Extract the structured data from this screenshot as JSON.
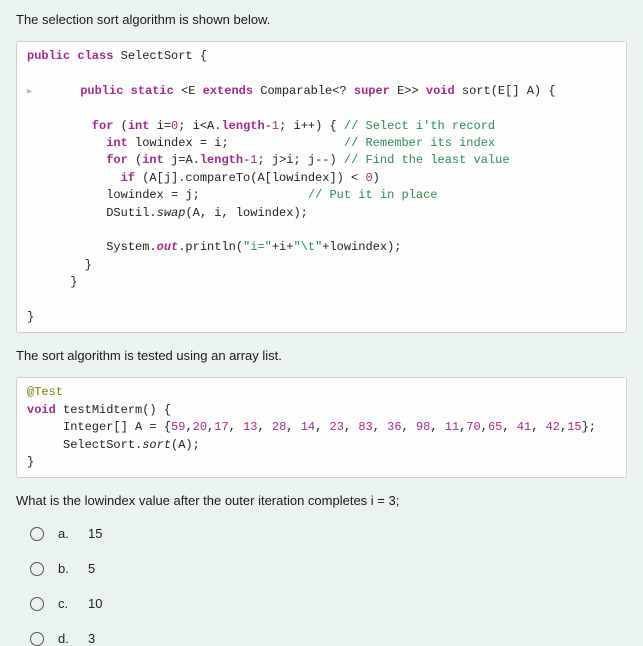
{
  "intro1": "The selection sort algorithm is shown below.",
  "code1": {
    "l1a": "public class ",
    "l1b": "SelectSort {",
    "l2a": "      public static ",
    "l2b": "<E ",
    "l2c": "extends ",
    "l2d": "Comparable<? ",
    "l2e": "super ",
    "l2f": "E>> ",
    "l2g": "void ",
    "l2h": "sort(E[] A) {",
    "l3a": "         for ",
    "l3b": "(",
    "l3c": "int ",
    "l3d": "i=",
    "l3e": "0",
    "l3f": "; i<A.",
    "l3g": "length",
    "l3h": "-",
    "l3i": "1",
    "l3j": "; i++) { ",
    "l3k": "// Select i'th record",
    "l4a": "           int ",
    "l4b": "lowindex = i;                ",
    "l4c": "// Remember its index",
    "l5a": "           for ",
    "l5b": "(",
    "l5c": "int ",
    "l5d": "j=A.",
    "l5e": "length",
    "l5f": "-",
    "l5g": "1",
    "l5h": "; j>i; j--) ",
    "l5i": "// Find the least value",
    "l6a": "             if ",
    "l6b": "(A[j].compareTo(A[lowindex]) < ",
    "l6c": "0",
    "l6d": ")",
    "l7a": "           lowindex = j;               ",
    "l7b": "// Put it in place",
    "l8a": "           DSutil.",
    "l8b": "swap",
    "l8c": "(A, i, lowindex);",
    "l9a": "           System.",
    "l9b": "out",
    "l9c": ".println(",
    "l9d": "\"i=\"",
    "l9e": "+i+",
    "l9f": "\"\\t\"",
    "l9g": "+lowindex);",
    "l10": "        }",
    "l11": "      }",
    "l12": "}"
  },
  "intro2": "The sort algorithm is tested using an array list.",
  "code2": {
    "l1": "@Test",
    "l2a": "void ",
    "l2b": "testMidterm() {",
    "l3a": "     Integer[] A = {",
    "l3b": "59",
    "l3c": ",",
    "l3d": "20",
    "l3e": ",",
    "l3f": "17",
    "l3g": ", ",
    "l3h": "13",
    "l3i": ", ",
    "l3j": "28",
    "l3k": ", ",
    "l3l": "14",
    "l3m": ", ",
    "l3n": "23",
    "l3o": ", ",
    "l3p": "83",
    "l3q": ", ",
    "l3r": "36",
    "l3s": ", ",
    "l3t": "98",
    "l3u": ", ",
    "l3v": "11",
    "l3w": ",",
    "l3x": "70",
    "l3y": ",",
    "l3z": "65",
    "l3aa": ", ",
    "l3ab": "41",
    "l3ac": ", ",
    "l3ad": "42",
    "l3ae": ",",
    "l3af": "15",
    "l3ag": "};",
    "l4a": "     SelectSort.",
    "l4b": "sort",
    "l4c": "(A);",
    "l5": "}"
  },
  "question": "What is the lowindex value after the outer iteration completes i = 3;",
  "options": [
    {
      "letter": "a.",
      "value": "15"
    },
    {
      "letter": "b.",
      "value": "5"
    },
    {
      "letter": "c.",
      "value": "10"
    },
    {
      "letter": "d.",
      "value": "3"
    }
  ]
}
